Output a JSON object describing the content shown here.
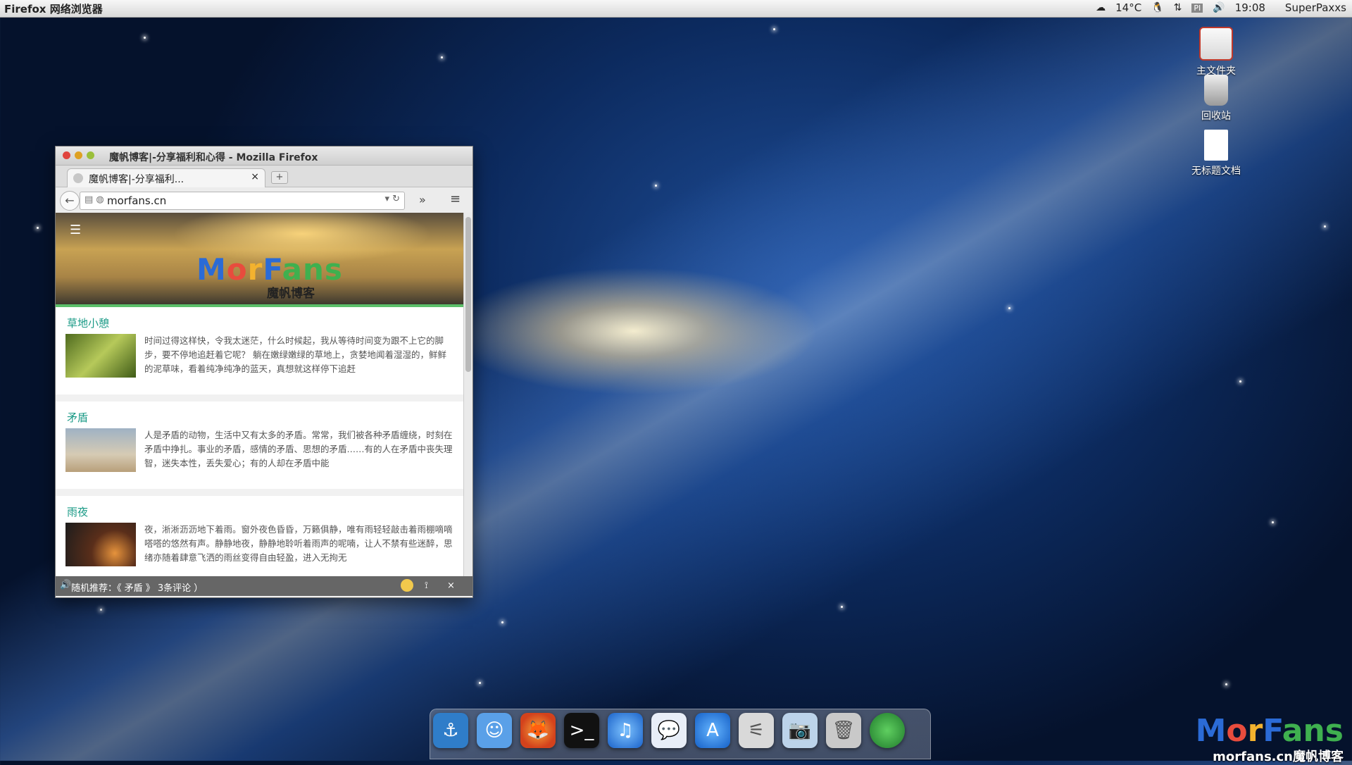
{
  "topbar": {
    "app_name": "Firefox 网络浏览器",
    "weather": "14°C",
    "time": "19:08",
    "user": "SuperPaxxs"
  },
  "desktop_icons": [
    {
      "label": "主文件夹",
      "icon": "home-folder-icon"
    },
    {
      "label": "回收站",
      "icon": "trash-icon"
    },
    {
      "label": "无标题文档",
      "icon": "document-icon"
    }
  ],
  "window": {
    "title": "魔帆博客|-分享福利和心得 - Mozilla Firefox",
    "tab_label": "魔帆博客|-分享福利...",
    "url": "morfans.cn"
  },
  "site": {
    "logo_text": "MorFans",
    "subtitle": "魔帆博客",
    "posts": [
      {
        "title": "草地小憩",
        "excerpt": "时间过得这样快，令我太迷茫，什么时候起，我从等待时间变为跟不上它的脚步，要不停地追赶着它呢？ 躺在嫩绿嫩绿的草地上，贪婪地闻着湿湿的，鲜鲜的泥草味，看着纯净纯净的蓝天，真想就这样停下追赶"
      },
      {
        "title": "矛盾",
        "excerpt": "人是矛盾的动物，生活中又有太多的矛盾。常常，我们被各种矛盾缠绕，时刻在矛盾中挣扎。事业的矛盾，感情的矛盾、思想的矛盾……有的人在矛盾中丧失理智，迷失本性，丢失爱心；有的人却在矛盾中能"
      },
      {
        "title": "雨夜",
        "excerpt": "夜，淅淅沥沥地下着雨。窗外夜色昏昏，万籁俱静，唯有雨轻轻敲击着雨棚嘀嘀嗒嗒的悠然有声。静静地夜，静静地聆听着雨声的呢喃，让人不禁有些迷醉，思绪亦随着肆意飞洒的雨丝变得自由轻盈，进入无拘无"
      }
    ],
    "status_text": "随机推荐：《 矛盾 》  3条评论  ）"
  },
  "watermark": {
    "logo": "MorFans",
    "url": "morfans.cn魔帆博客"
  }
}
